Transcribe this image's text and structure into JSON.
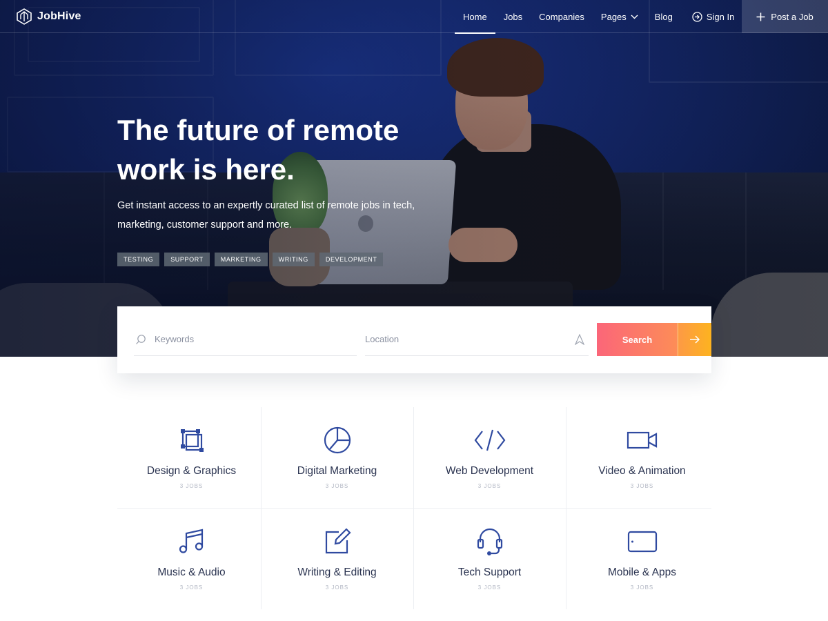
{
  "brand": {
    "name": "JobHive"
  },
  "nav": {
    "links": [
      {
        "label": "Home",
        "active": true
      },
      {
        "label": "Jobs"
      },
      {
        "label": "Companies"
      },
      {
        "label": "Pages"
      },
      {
        "label": "Blog"
      }
    ],
    "signin": "Sign In",
    "post_job": "Post a Job"
  },
  "hero": {
    "title": "The future of remote work is here.",
    "subtitle": "Get instant access to an expertly curated list of remote jobs in tech, marketing, customer support and more.",
    "tags": [
      "TESTING",
      "SUPPORT",
      "MARKETING",
      "WRITING",
      "DEVELOPMENT"
    ]
  },
  "search": {
    "keywords_placeholder": "Keywords",
    "location_placeholder": "Location",
    "button_label": "Search"
  },
  "categories": [
    {
      "title": "Design & Graphics",
      "count": "3 JOBS",
      "icon": "design-icon"
    },
    {
      "title": "Digital Marketing",
      "count": "3 JOBS",
      "icon": "pie-chart-icon"
    },
    {
      "title": "Web Development",
      "count": "3 JOBS",
      "icon": "code-icon"
    },
    {
      "title": "Video & Animation",
      "count": "3 JOBS",
      "icon": "video-camera-icon"
    },
    {
      "title": "Music & Audio",
      "count": "3 JOBS",
      "icon": "music-note-icon"
    },
    {
      "title": "Writing & Editing",
      "count": "3 JOBS",
      "icon": "edit-icon"
    },
    {
      "title": "Tech Support",
      "count": "3 JOBS",
      "icon": "headset-icon"
    },
    {
      "title": "Mobile & Apps",
      "count": "3 JOBS",
      "icon": "tablet-icon"
    }
  ],
  "colors": {
    "accent_icon": "#2f4aa0",
    "search_gradient_start": "#fb6679",
    "search_gradient_end": "#fdb31f"
  }
}
